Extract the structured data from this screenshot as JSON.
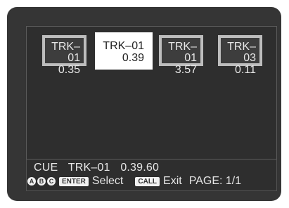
{
  "cues": [
    {
      "track": "TRK–01",
      "time": "0.35",
      "selected": false
    },
    {
      "track": "TRK–01",
      "time": "0.39",
      "selected": true
    },
    {
      "track": "TRK–01",
      "time": "3.57",
      "selected": false
    },
    {
      "track": "TRK–03",
      "time": "0.11",
      "selected": false
    }
  ],
  "status": {
    "mode": "CUE",
    "track": "TRK–01",
    "time": "0.39.60"
  },
  "footer": {
    "button_a": "A",
    "button_b": "B",
    "button_c": "C",
    "enter_key": "ENTER",
    "select_label": "Select",
    "call_key": "CALL",
    "exit_label": "Exit",
    "page_label": "PAGE: 1/1"
  },
  "colors": {
    "frame": "#353535",
    "panel": "#2e2e2e",
    "selected_bg": "#ffffff",
    "border": "#bdbdbd"
  }
}
